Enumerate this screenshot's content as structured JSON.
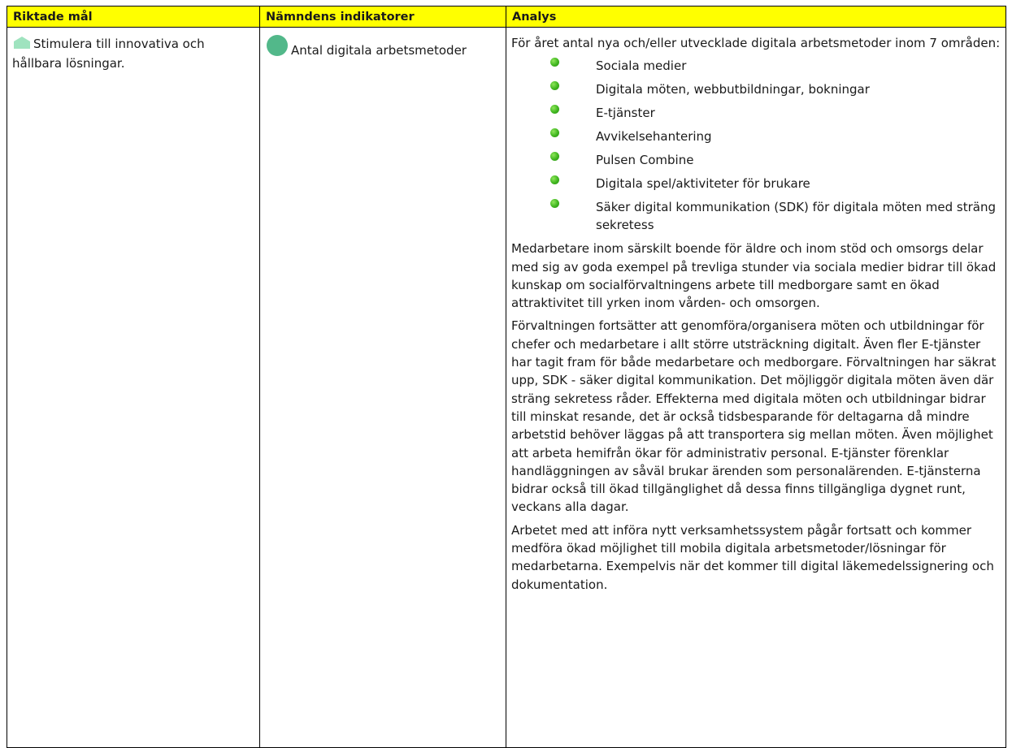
{
  "table": {
    "headers": [
      "Riktade mål",
      "Nämndens indikatorer",
      "Analys"
    ],
    "header_color": "#ffff00",
    "goal": {
      "icon": "house-status-icon",
      "icon_color": "#9fe3bf",
      "text": "Stimulera till innovativa och hållbara lösningar."
    },
    "indicator": {
      "icon": "circle-status-icon",
      "icon_color": "#52b88a",
      "text": "Antal digitala arbetsmetoder"
    },
    "analysis": {
      "intro": "För året antal nya och/eller utvecklade digitala arbetsmetoder inom 7 områden:",
      "bullet_color": "#3fb51f",
      "bullets": [
        "Sociala medier",
        "Digitala möten, webbutbildningar, bokningar",
        "E-tjänster",
        "Avvikelsehantering",
        "Pulsen Combine",
        "Digitala spel/aktiviteter för brukare",
        "Säker digital kommunikation (SDK) för digitala möten med sträng sekretess"
      ],
      "paragraphs": [
        "Medarbetare inom särskilt boende för äldre och inom stöd och omsorgs delar med sig av goda exempel på trevliga stunder via sociala medier bidrar till ökad kunskap om socialförvaltningens arbete till medborgare samt en ökad attraktivitet till yrken inom vården- och omsorgen.",
        "Förvaltningen fortsätter att genomföra/organisera möten och utbildningar för chefer och medarbetare i allt större utsträckning digitalt. Även fler E-tjänster har tagit fram för både medarbetare och medborgare. Förvaltningen har säkrat upp, SDK - säker digital kommunikation. Det möjliggör digitala möten även där sträng sekretess råder. Effekterna med digitala möten och utbildningar bidrar till minskat resande, det är också tidsbesparande för deltagarna då mindre arbetstid behöver läggas på att transportera sig mellan möten. Även möjlighet att arbeta hemifrån ökar för administrativ personal. E-tjänster förenklar handläggningen av såväl brukar ärenden som personalärenden. E-tjänsterna bidrar också till ökad tillgänglighet då dessa finns tillgängliga dygnet runt, veckans alla dagar.",
        "Arbetet med att införa nytt verksamhetssystem pågår fortsatt och kommer medföra ökad möjlighet till mobila digitala arbetsmetoder/lösningar för medarbetarna. Exempelvis när det kommer till digital läkemedelssignering och dokumentation."
      ]
    }
  }
}
